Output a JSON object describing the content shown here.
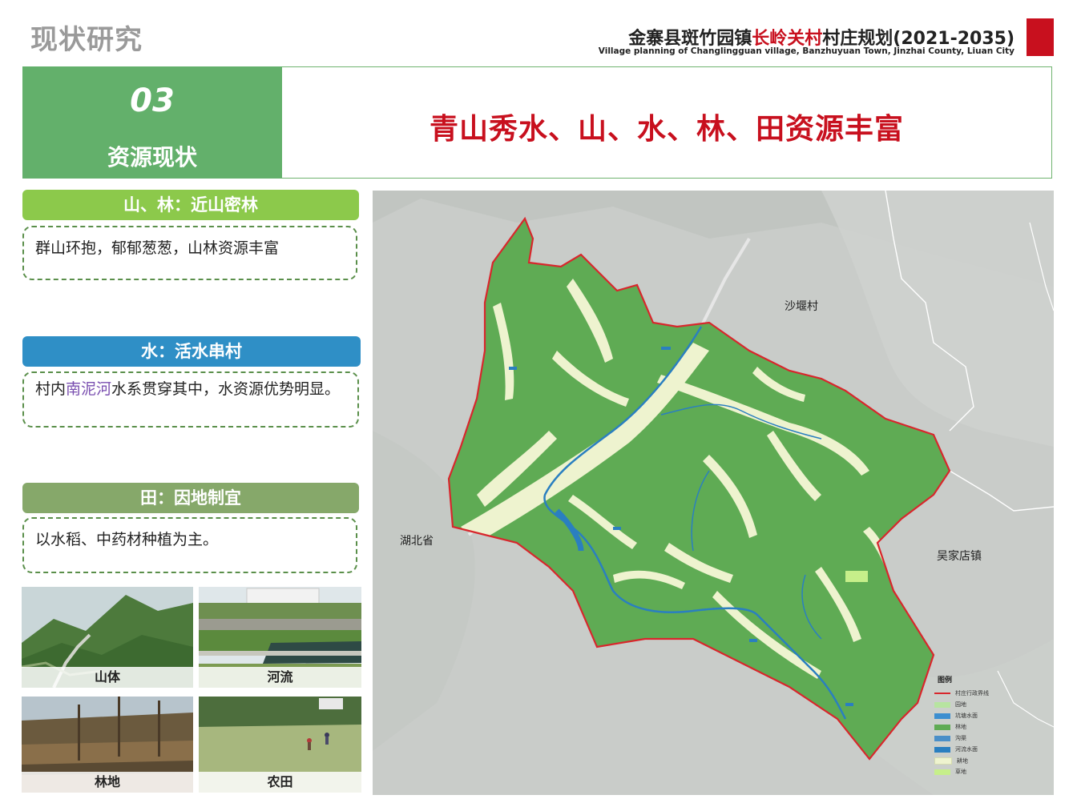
{
  "header": {
    "section_title": "现状研究",
    "title_prefix": "金寨县斑竹园镇",
    "title_highlight": "长岭关村",
    "title_suffix": "村庄规划(2021-2035)",
    "subtitle": "Village planning of Changlingguan village, Banzhuyuan Town, Jinzhai County, Liuan City",
    "accent_color": "#c8101e"
  },
  "section": {
    "number": "03",
    "label": "资源现状",
    "headline": "青山秀水、山、水、林、田资源丰富"
  },
  "categories": [
    {
      "title": "山、林：近山密林",
      "color": "#8cc94b",
      "text": "群山环抱，郁郁葱葱，山林资源丰富"
    },
    {
      "title": "水：活水串村",
      "color": "#2f8fc6",
      "text_before": "村内",
      "text_highlight": "南泥河",
      "text_after": "水系贯穿其中，水资源优势明显。",
      "highlight_color": "#7a4fb0"
    },
    {
      "title": "田：因地制宜",
      "color": "#86a86a",
      "text": "以水稻、中药材种植为主。"
    }
  ],
  "photos": [
    {
      "label": "山体",
      "icon": "mountain-photo"
    },
    {
      "label": "河流",
      "icon": "river-photo"
    },
    {
      "label": "林地",
      "icon": "forest-photo"
    },
    {
      "label": "农田",
      "icon": "farmland-photo"
    }
  ],
  "map": {
    "labels": {
      "north": "沙堰村",
      "west": "湖北省",
      "east": "吴家店镇"
    },
    "colors": {
      "forest": "#5fab54",
      "farmland": "#eef3cf",
      "water": "#2a7fc0",
      "boundary": "#d8262c",
      "basemap": "#c9ccc9"
    }
  },
  "legend": {
    "title": "图例",
    "items": [
      {
        "label": "村庄行政界线",
        "color": "#d8262c",
        "type": "line"
      },
      {
        "label": "园地",
        "color": "#b7e4a0",
        "type": "fill"
      },
      {
        "label": "坑塘水面",
        "color": "#3c8fd0",
        "type": "fill"
      },
      {
        "label": "林地",
        "color": "#5fab54",
        "type": "fill"
      },
      {
        "label": "沟渠",
        "color": "#4a8fc8",
        "type": "fill"
      },
      {
        "label": "河流水面",
        "color": "#2a7fc0",
        "type": "fill"
      },
      {
        "label": "耕地",
        "color": "#eef3cf",
        "type": "fill"
      },
      {
        "label": "草地",
        "color": "#c6ef8a",
        "type": "fill"
      }
    ]
  }
}
